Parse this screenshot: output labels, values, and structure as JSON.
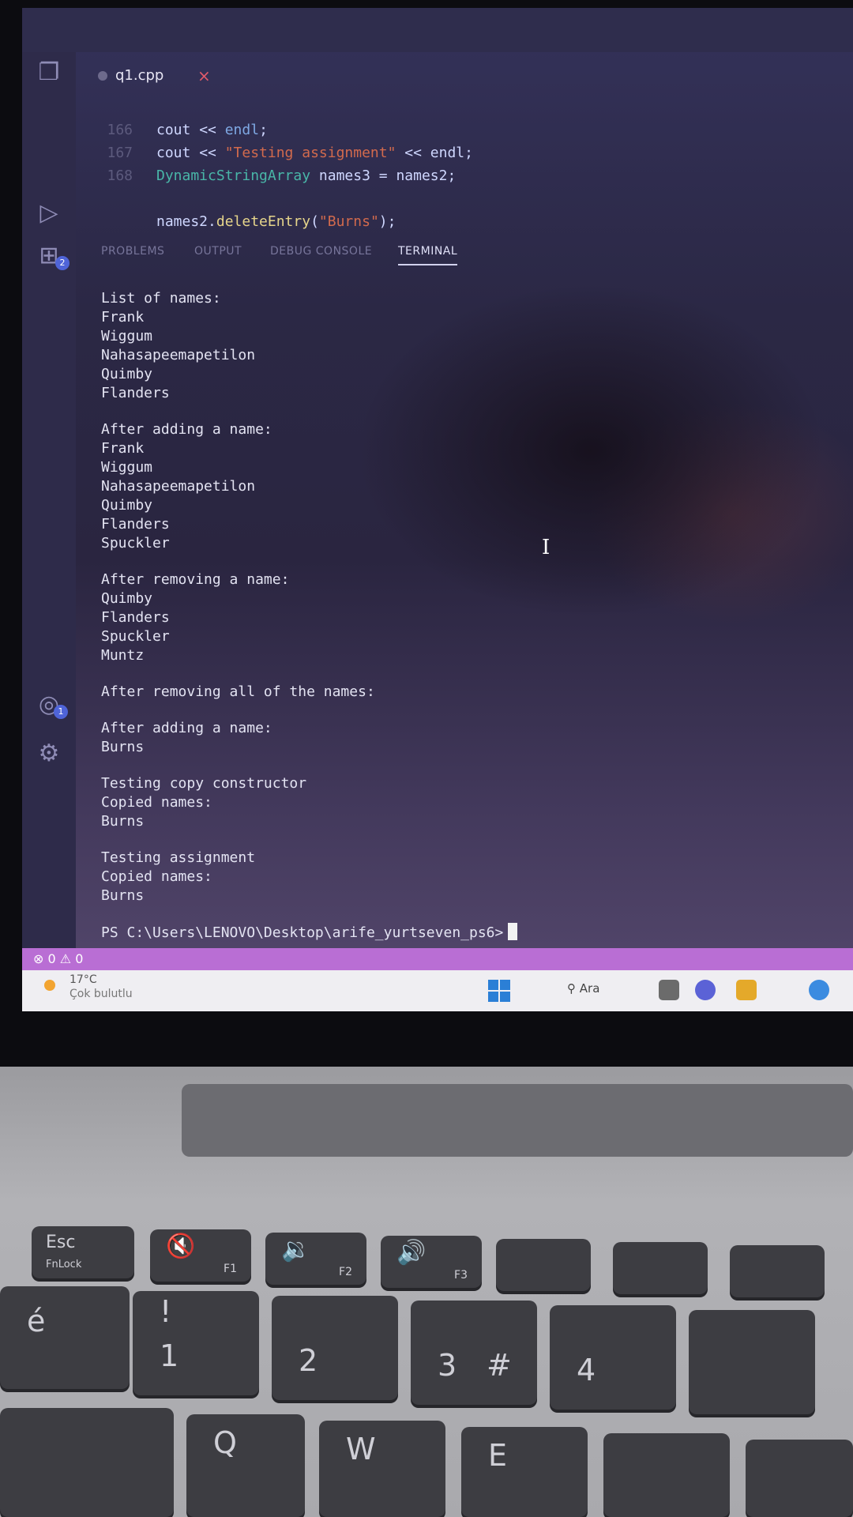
{
  "editor": {
    "tab": {
      "filename": "q1.cpp",
      "close": "×"
    },
    "code_lines": [
      {
        "num": "166",
        "parts": [
          {
            "cls": "var",
            "t": "cout "
          },
          {
            "cls": "var",
            "t": "<< "
          },
          {
            "cls": "kw",
            "t": "endl"
          },
          {
            "cls": "var",
            "t": ";"
          }
        ]
      },
      {
        "num": "167",
        "parts": [
          {
            "cls": "var",
            "t": "cout "
          },
          {
            "cls": "var",
            "t": "<< "
          },
          {
            "cls": "str",
            "t": "\"Testing assignment\""
          },
          {
            "cls": "var",
            "t": " << endl;"
          }
        ]
      },
      {
        "num": "168",
        "parts": [
          {
            "cls": "ty",
            "t": "DynamicStringArray "
          },
          {
            "cls": "var",
            "t": "names3 = names2;"
          }
        ]
      },
      {
        "num": "",
        "parts": []
      },
      {
        "num": "",
        "parts": [
          {
            "cls": "var",
            "t": "names2."
          },
          {
            "cls": "fn",
            "t": "deleteEntry"
          },
          {
            "cls": "var",
            "t": "("
          },
          {
            "cls": "str",
            "t": "\"Burns\""
          },
          {
            "cls": "var",
            "t": ");"
          }
        ]
      }
    ]
  },
  "panel": {
    "tabs": [
      "PROBLEMS",
      "OUTPUT",
      "DEBUG CONSOLE",
      "TERMINAL"
    ],
    "active_tab": "TERMINAL"
  },
  "terminal": {
    "blocks": [
      [
        "List of names:",
        "Frank",
        "Wiggum",
        "Nahasapeemapetilon",
        "Quimby",
        "Flanders"
      ],
      [
        "After adding a name:",
        "Frank",
        "Wiggum",
        "Nahasapeemapetilon",
        "Quimby",
        "Flanders",
        "Spuckler"
      ],
      [
        "After removing a name:",
        "Quimby",
        "Flanders",
        "Spuckler",
        "Muntz"
      ],
      [
        "After removing all of the names:"
      ],
      [
        "After adding a name:",
        "Burns"
      ],
      [
        "Testing copy constructor",
        "Copied names:",
        "Burns"
      ],
      [
        "Testing assignment",
        "Copied names:",
        "Burns"
      ]
    ],
    "prompt": "PS C:\\Users\\LENOVO\\Desktop\\arife_yurtseven_ps6>"
  },
  "activity_badges": {
    "source_control": "2",
    "accounts": "1"
  },
  "statusbar": {
    "errors": "0",
    "warnings": "0"
  },
  "taskbar": {
    "weather_temp": "17°C",
    "weather_desc": "Çok bulutlu",
    "search_label": "Ara"
  },
  "keyboard": {
    "esc": "Esc",
    "fnlock": "FnLock",
    "f1": "F1",
    "f2": "F2",
    "f3": "F3",
    "key1": "1",
    "key1_alt": "!",
    "key2": "2",
    "key3": "3",
    "key3_alt": "#",
    "key4": "4",
    "q": "Q",
    "w": "W",
    "e": "E",
    "e_acute": "é"
  },
  "colors": {
    "statusbar": "#b96ed4",
    "taskbar": "#efeef2",
    "terminal_text": "#e3e3f2"
  }
}
